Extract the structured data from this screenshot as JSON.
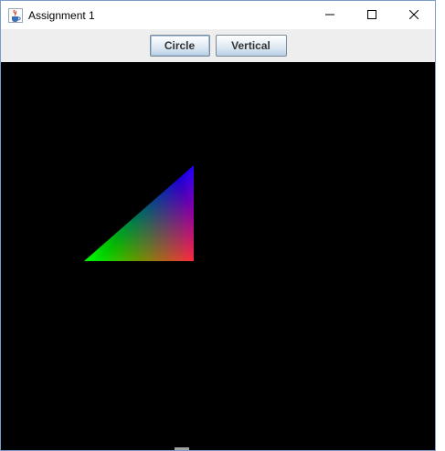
{
  "window": {
    "title": "Assignment 1",
    "icon": "java-cup-icon",
    "controls": [
      "minimize-icon",
      "maximize-icon",
      "close-icon"
    ]
  },
  "toolbar": {
    "circle_label": "Circle",
    "vertical_label": "Vertical"
  },
  "canvas": {
    "background": "#000000",
    "shape": "triangle",
    "vertex_colors": [
      "#ff0000",
      "#00ff00",
      "#0000ff"
    ]
  }
}
